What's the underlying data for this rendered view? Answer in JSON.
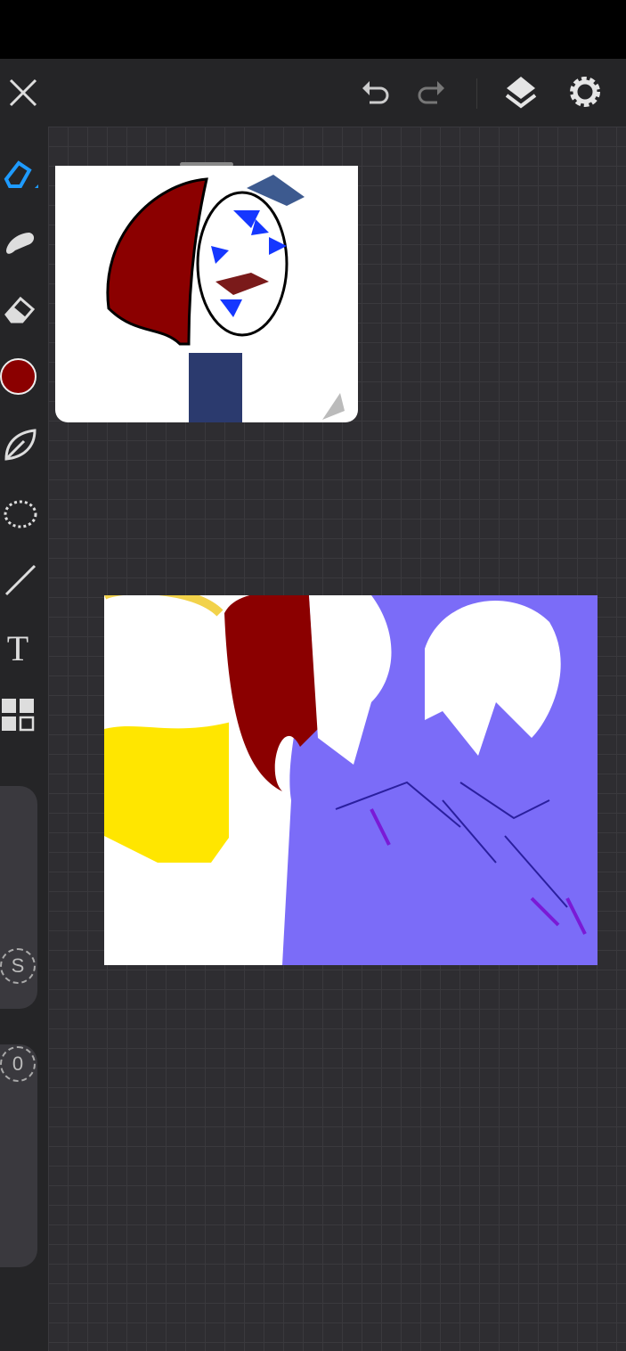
{
  "toolbar": {
    "close": "close-icon",
    "undo": "undo-icon",
    "redo": "redo-icon",
    "layers": "layers-icon",
    "settings": "gear-icon"
  },
  "tools": [
    "brush",
    "smudge",
    "eraser",
    "color",
    "leaf-brush",
    "lasso",
    "line",
    "text",
    "gallery"
  ],
  "current_color": "#8b0000",
  "text_tool_label": "T",
  "size_slider": {
    "label": "S"
  },
  "opacity_slider": {
    "label": "0"
  }
}
